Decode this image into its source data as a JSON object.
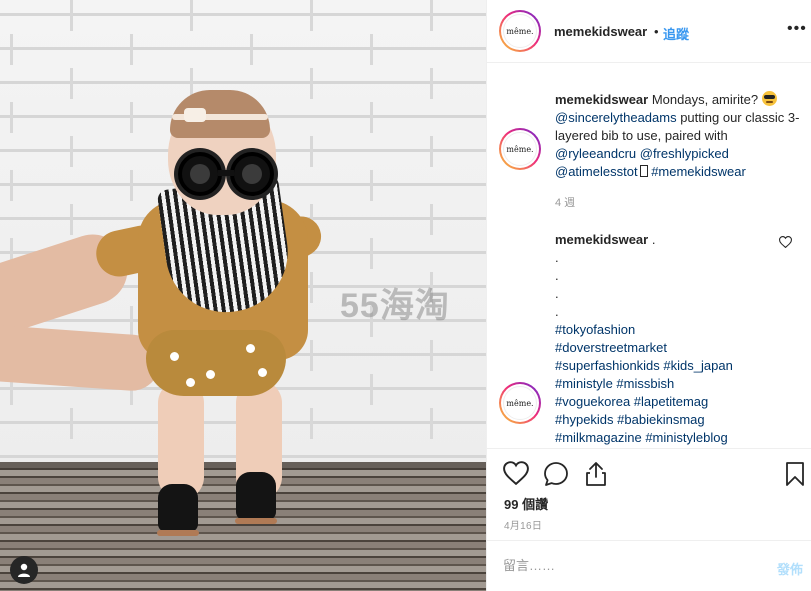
{
  "photo": {
    "watermark_digits": "55",
    "watermark_text": "海淘",
    "user_tag_icon": "person-icon"
  },
  "header": {
    "avatar_text": "même.",
    "username": "memekidswear",
    "separator": "•",
    "follow_label": "追蹤",
    "more_icon": "more-dots-icon"
  },
  "caption": {
    "avatar_text": "même.",
    "username": "memekidswear",
    "text_1": " Mondays, amirite? ",
    "mention_1": "@sincerelytheadams",
    "text_2": " putting our classic 3-layered bib to use, paired with ",
    "mention_2": "@ryleeandcru",
    "mention_3": "@freshlypicked",
    "mention_4": "@atimelesstot",
    "hashtag_1": "#memekidswear",
    "time": "4 週"
  },
  "comment": {
    "avatar_text": "même.",
    "username": "memekidswear",
    "first_line": " .",
    "dots": [
      ".",
      ".",
      ".",
      "."
    ],
    "hashtags": [
      [
        "#tokyofashion"
      ],
      [
        "#doverstreetmarket"
      ],
      [
        "#superfashionkids",
        "#kids_japan"
      ],
      [
        "#ministyle",
        "#missbish"
      ],
      [
        "#voguekorea",
        "#lapetitemag"
      ],
      [
        "#hypekids",
        "#babiekinsmag"
      ],
      [
        "#milkmagazine",
        "#ministyleblog"
      ]
    ]
  },
  "actions": {
    "likes": "99 個讚",
    "date": "4月16日"
  },
  "add_comment": {
    "placeholder": "留言……",
    "post_label": "發佈"
  },
  "colors": {
    "link": "#003569",
    "follow": "#3897f0",
    "post_disabled": "#b2dffc",
    "muted": "#999999"
  }
}
